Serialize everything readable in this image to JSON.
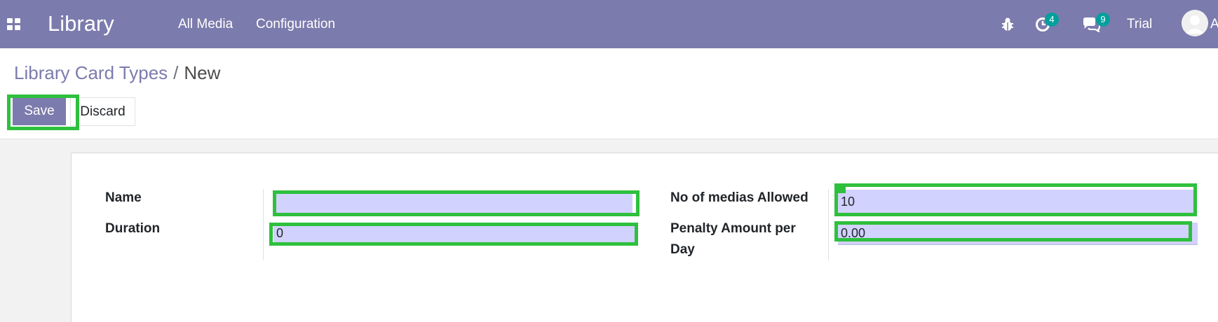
{
  "navbar": {
    "brand": "Library",
    "menu": [
      "All Media",
      "Configuration"
    ],
    "activity_count": "4",
    "messages_count": "9",
    "trial_label": "Trial",
    "user_initial": "A"
  },
  "breadcrumb": {
    "parent": "Library Card Types",
    "separator": "/",
    "current": "New"
  },
  "actions": {
    "save_label": "Save",
    "discard_label": "Discard"
  },
  "form": {
    "name_label": "Name",
    "name_value": "",
    "duration_label": "Duration",
    "duration_value": "0",
    "medias_label": "No of medias Allowed",
    "medias_value": "10",
    "penalty_label_line1": "Penalty Amount per",
    "penalty_label_line2": "Day",
    "penalty_value": "0.00"
  },
  "colors": {
    "brand": "#7c7bad",
    "badge": "#00a09d",
    "highlight": "#2ec03d",
    "field_bg": "#d2d2ff"
  },
  "icons": [
    "apps-grid-icon",
    "bug-icon",
    "activity-clock-icon",
    "chat-icon",
    "user-avatar-icon"
  ]
}
